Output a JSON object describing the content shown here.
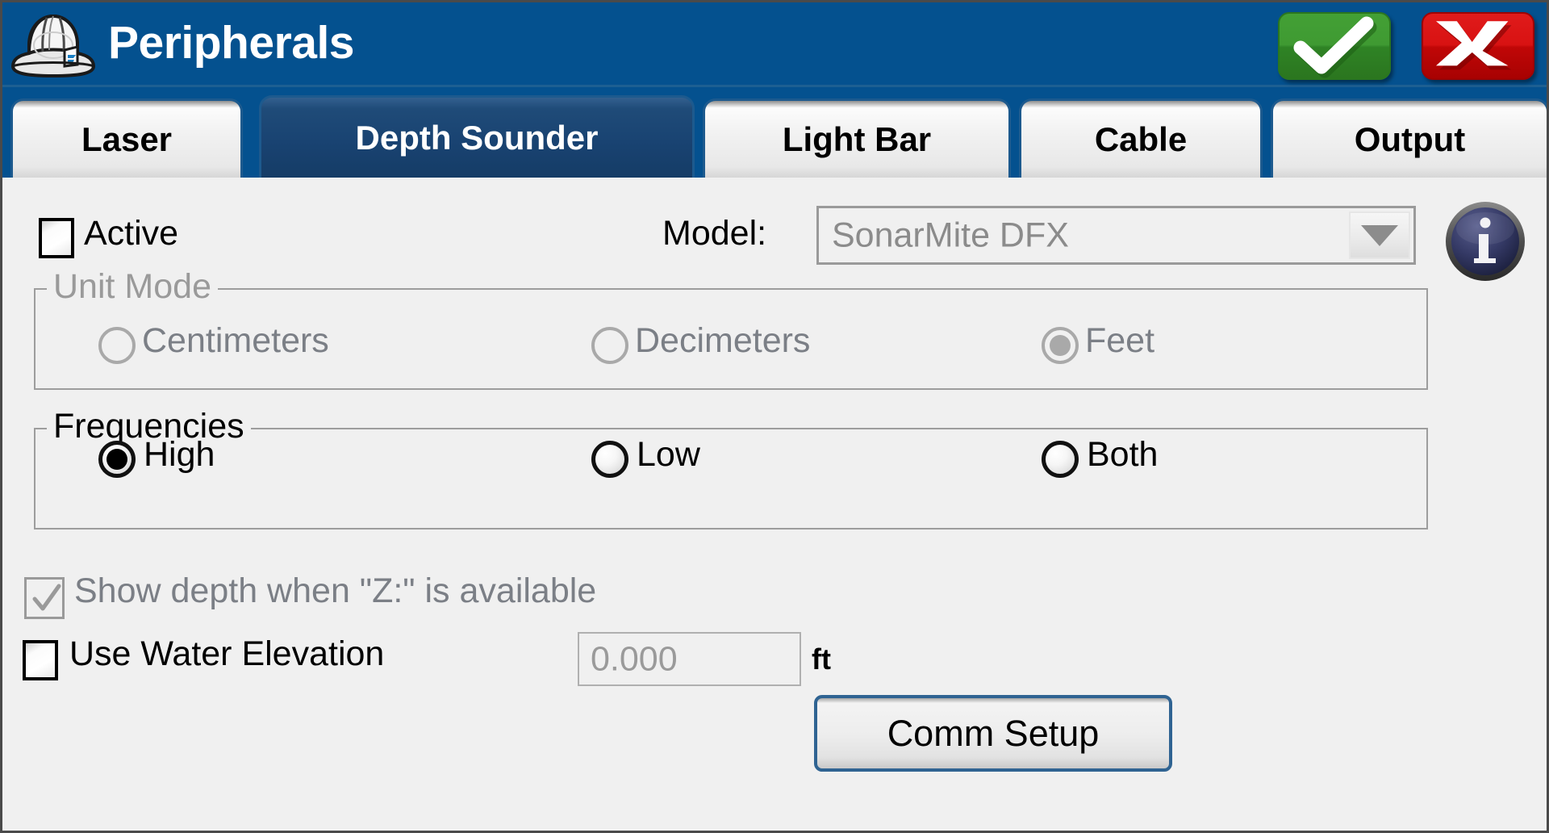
{
  "window": {
    "title": "Peripherals",
    "icon": "hard-hat-icon",
    "accent_color": "#04518f",
    "ok_button": {
      "icon": "checkmark-icon",
      "color": "#3b9630"
    },
    "cancel_button": {
      "icon": "x-mark-icon",
      "label": "X",
      "color": "#cc0a0a"
    }
  },
  "tabs": [
    {
      "label": "Laser",
      "active": false
    },
    {
      "label": "Depth Sounder",
      "active": true
    },
    {
      "label": "Light Bar",
      "active": false
    },
    {
      "label": "Cable",
      "active": false
    },
    {
      "label": "Output",
      "active": false
    }
  ],
  "form": {
    "active_checkbox": {
      "label": "Active",
      "checked": false,
      "enabled": true
    },
    "model": {
      "label": "Model:",
      "value": "SonarMite DFX",
      "enabled": false,
      "dropdown_icon": "chevron-down-icon"
    },
    "info_icon": {
      "name": "info-icon",
      "glyph": "i"
    },
    "unit_mode": {
      "title": "Unit Mode",
      "enabled": false,
      "options": [
        {
          "label": "Centimeters",
          "selected": false
        },
        {
          "label": "Decimeters",
          "selected": false
        },
        {
          "label": "Feet",
          "selected": true
        }
      ]
    },
    "frequencies": {
      "title": "Frequencies",
      "enabled": true,
      "options": [
        {
          "label": "High",
          "selected": true
        },
        {
          "label": "Low",
          "selected": false
        },
        {
          "label": "Both",
          "selected": false
        }
      ]
    },
    "show_depth": {
      "label": "Show depth when \"Z:\" is available",
      "checked": true,
      "enabled": false
    },
    "use_water_elevation": {
      "label": "Use Water Elevation",
      "checked": false,
      "enabled": true
    },
    "water_elevation_value": {
      "value": "0.000",
      "units": "ft",
      "enabled": false
    },
    "comm_setup_button": {
      "label": "Comm Setup"
    }
  }
}
